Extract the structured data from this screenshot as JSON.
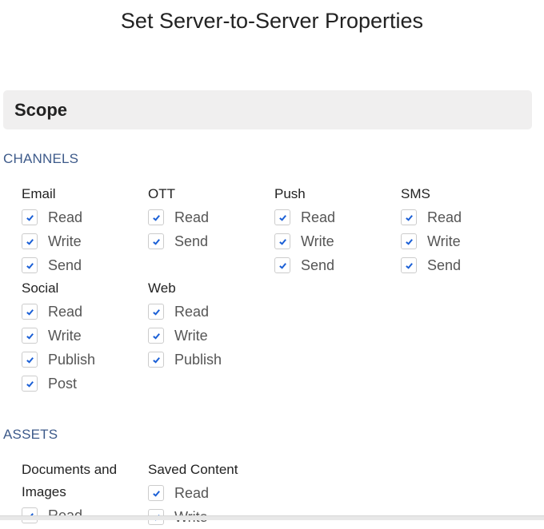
{
  "page_title": "Set Server-to-Server Properties",
  "scope_header": "Scope",
  "sections": {
    "channels": {
      "label": "CHANNELS",
      "groups": [
        {
          "name": "Email",
          "items": [
            {
              "label": "Read",
              "checked": true
            },
            {
              "label": "Write",
              "checked": true
            },
            {
              "label": "Send",
              "checked": true
            }
          ]
        },
        {
          "name": "OTT",
          "items": [
            {
              "label": "Read",
              "checked": true
            },
            {
              "label": "Send",
              "checked": true
            }
          ]
        },
        {
          "name": "Push",
          "items": [
            {
              "label": "Read",
              "checked": true
            },
            {
              "label": "Write",
              "checked": true
            },
            {
              "label": "Send",
              "checked": true
            }
          ]
        },
        {
          "name": "SMS",
          "items": [
            {
              "label": "Read",
              "checked": true
            },
            {
              "label": "Write",
              "checked": true
            },
            {
              "label": "Send",
              "checked": true
            }
          ]
        },
        {
          "name": "Social",
          "items": [
            {
              "label": "Read",
              "checked": true
            },
            {
              "label": "Write",
              "checked": true
            },
            {
              "label": "Publish",
              "checked": true
            },
            {
              "label": "Post",
              "checked": true
            }
          ]
        },
        {
          "name": "Web",
          "items": [
            {
              "label": "Read",
              "checked": true
            },
            {
              "label": "Write",
              "checked": true
            },
            {
              "label": "Publish",
              "checked": true
            }
          ]
        }
      ]
    },
    "assets": {
      "label": "ASSETS",
      "groups": [
        {
          "name_line1": "Documents and",
          "name_line2": "Images",
          "items": [
            {
              "label": "Read",
              "checked": true
            }
          ]
        },
        {
          "name": "Saved Content",
          "items": [
            {
              "label": "Read",
              "checked": true
            },
            {
              "label": "Write",
              "checked": true
            }
          ]
        }
      ]
    }
  },
  "colors": {
    "section_label": "#3d5a8a",
    "check": "#1a5fd6",
    "scope_bg": "#f0efef"
  }
}
